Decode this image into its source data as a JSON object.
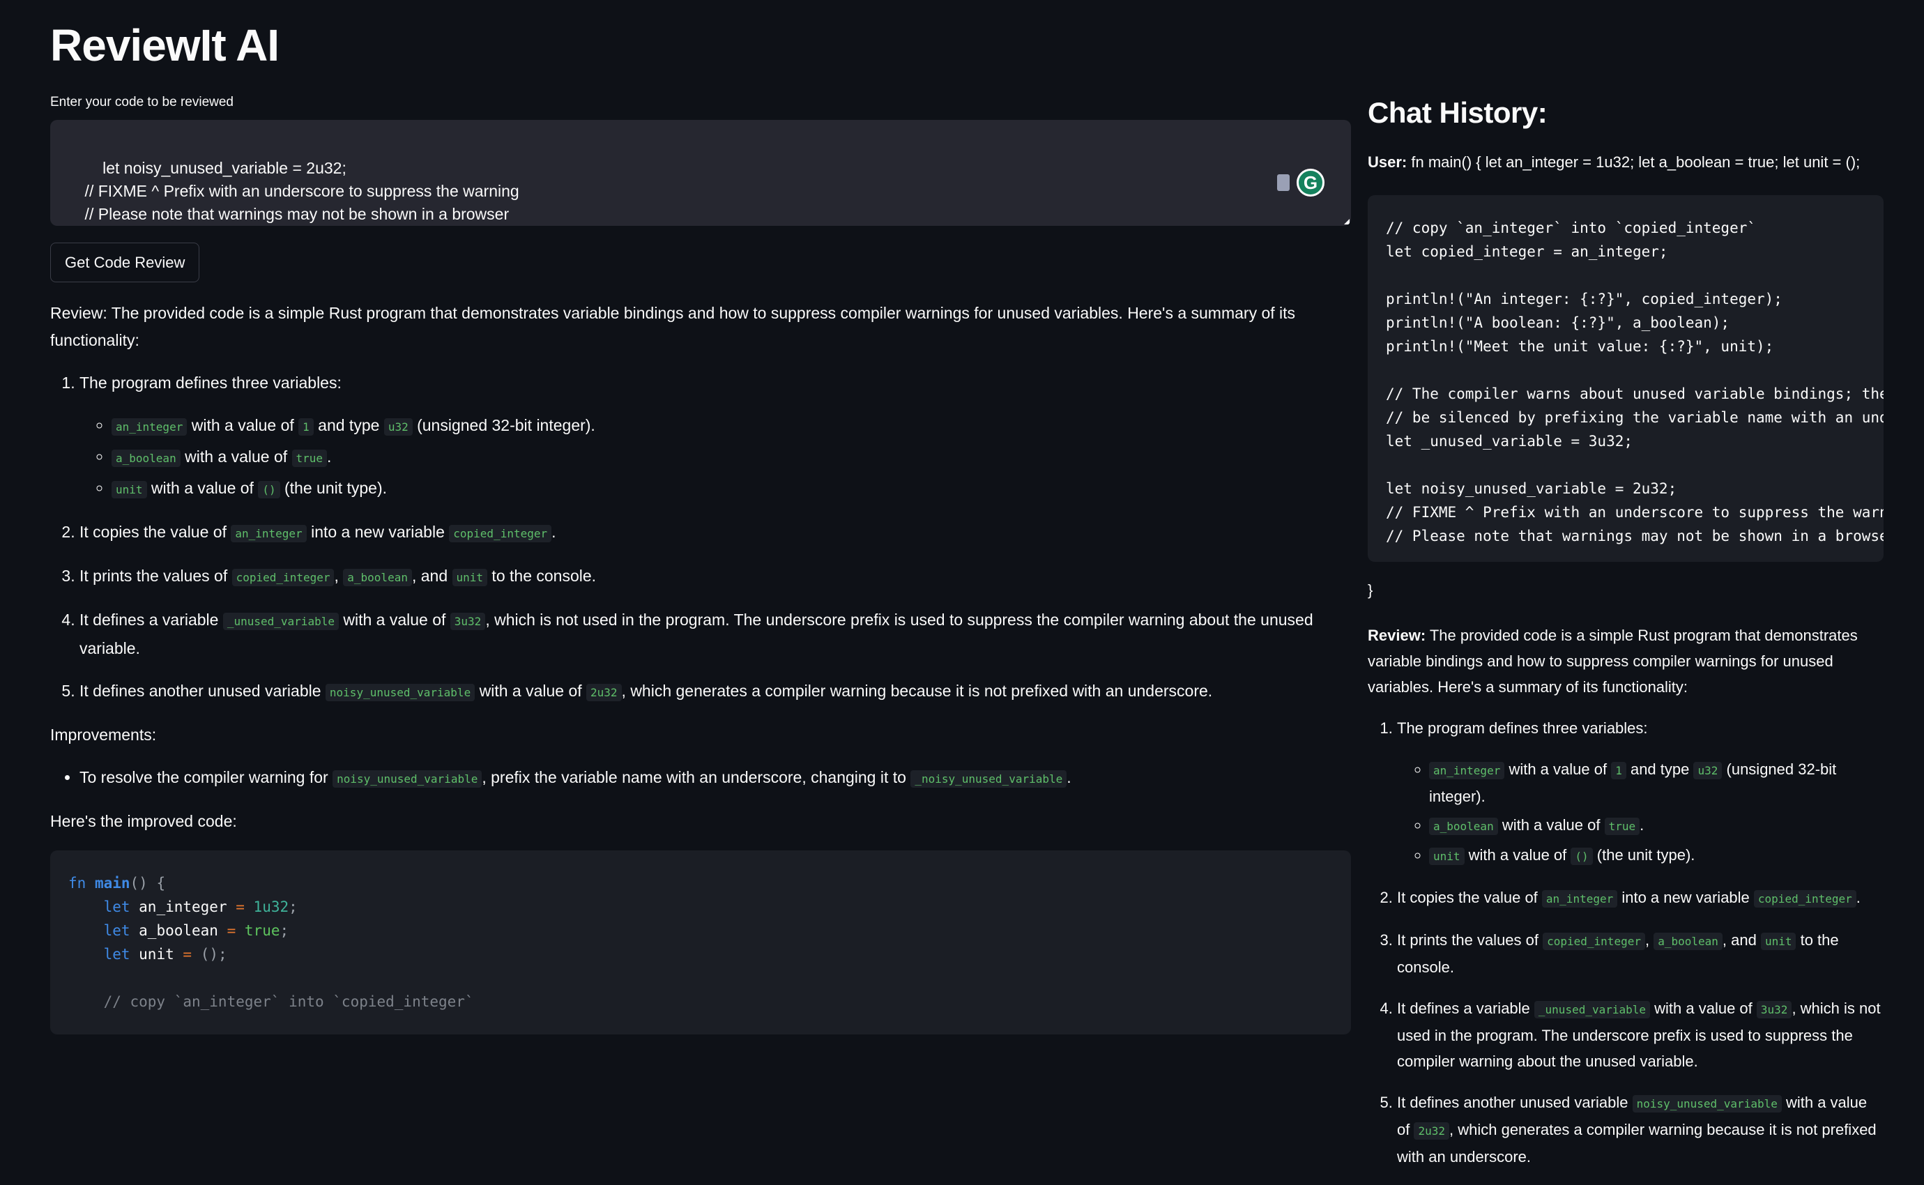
{
  "app": {
    "title": "ReviewIt AI"
  },
  "input": {
    "label": "Enter your code to be reviewed",
    "value": "    let noisy_unused_variable = 2u32;\n    // FIXME ^ Prefix with an underscore to suppress the warning\n    // Please note that warnings may not be shown in a browser\n}",
    "grammarly_icon": "G"
  },
  "button": {
    "label": "Get Code Review"
  },
  "review": {
    "intro": [
      {
        "t": "Review: The provided code is a simple Rust program that demonstrates variable bindings and how to suppress compiler warnings for unused variables. Here's a summary of its functionality:"
      }
    ],
    "items": [
      {
        "parts": [
          {
            "t": "The program defines three variables:"
          }
        ],
        "sub": [
          [
            {
              "t": "an_integer",
              "c": 1
            },
            {
              "t": " with a value of "
            },
            {
              "t": "1",
              "c": 1
            },
            {
              "t": " and type "
            },
            {
              "t": "u32",
              "c": 1
            },
            {
              "t": " (unsigned 32-bit integer)."
            }
          ],
          [
            {
              "t": "a_boolean",
              "c": 1
            },
            {
              "t": " with a value of "
            },
            {
              "t": "true",
              "c": 1
            },
            {
              "t": "."
            }
          ],
          [
            {
              "t": "unit",
              "c": 1
            },
            {
              "t": " with a value of "
            },
            {
              "t": "()",
              "c": 1
            },
            {
              "t": " (the unit type)."
            }
          ]
        ]
      },
      {
        "parts": [
          {
            "t": "It copies the value of "
          },
          {
            "t": "an_integer",
            "c": 1
          },
          {
            "t": " into a new variable "
          },
          {
            "t": "copied_integer",
            "c": 1
          },
          {
            "t": "."
          }
        ]
      },
      {
        "parts": [
          {
            "t": "It prints the values of "
          },
          {
            "t": "copied_integer",
            "c": 1
          },
          {
            "t": ", "
          },
          {
            "t": "a_boolean",
            "c": 1
          },
          {
            "t": ", and "
          },
          {
            "t": "unit",
            "c": 1
          },
          {
            "t": " to the console."
          }
        ]
      },
      {
        "parts": [
          {
            "t": "It defines a variable "
          },
          {
            "t": "_unused_variable",
            "c": 1
          },
          {
            "t": " with a value of "
          },
          {
            "t": "3u32",
            "c": 1
          },
          {
            "t": ", which is not used in the program. The underscore prefix is used to suppress the compiler warning about the unused variable."
          }
        ]
      },
      {
        "parts": [
          {
            "t": "It defines another unused variable "
          },
          {
            "t": "noisy_unused_variable",
            "c": 1
          },
          {
            "t": " with a value of "
          },
          {
            "t": "2u32",
            "c": 1
          },
          {
            "t": ", which generates a compiler warning because it is not prefixed with an underscore."
          }
        ]
      }
    ],
    "improvements_label": "Improvements:",
    "improvements": [
      [
        {
          "t": "To resolve the compiler warning for "
        },
        {
          "t": "noisy_unused_variable",
          "c": 1
        },
        {
          "t": ", prefix the variable name with an underscore, changing it to "
        },
        {
          "t": "_noisy_unused_variable",
          "c": 1
        },
        {
          "t": "."
        }
      ]
    ],
    "improved_label": "Here's the improved code:",
    "improved_code": [
      [
        {
          "t": "fn",
          "k": "kw"
        },
        {
          "t": " "
        },
        {
          "t": "main",
          "k": "fn"
        },
        {
          "t": "() {",
          "k": "pn"
        }
      ],
      [
        {
          "t": "    "
        },
        {
          "t": "let",
          "k": "kw"
        },
        {
          "t": " an_integer "
        },
        {
          "t": "=",
          "k": "op"
        },
        {
          "t": " "
        },
        {
          "t": "1u32",
          "k": "num"
        },
        {
          "t": ";",
          "k": "pn"
        }
      ],
      [
        {
          "t": "    "
        },
        {
          "t": "let",
          "k": "kw"
        },
        {
          "t": " a_boolean "
        },
        {
          "t": "=",
          "k": "op"
        },
        {
          "t": " "
        },
        {
          "t": "true",
          "k": "bool"
        },
        {
          "t": ";",
          "k": "pn"
        }
      ],
      [
        {
          "t": "    "
        },
        {
          "t": "let",
          "k": "kw"
        },
        {
          "t": " unit "
        },
        {
          "t": "=",
          "k": "op"
        },
        {
          "t": " "
        },
        {
          "t": "();",
          "k": "pn"
        }
      ],
      [
        {
          "t": " "
        }
      ],
      [
        {
          "t": "    // copy `an_integer` into `copied_integer`",
          "k": "cm"
        }
      ]
    ]
  },
  "chat_history": {
    "title": "Chat History:",
    "user_label": "User:",
    "user_text": " fn main() { let an_integer = 1u32; let a_boolean = true; let unit = ();",
    "code": "// copy `an_integer` into `copied_integer`\nlet copied_integer = an_integer;\n\nprintln!(\"An integer: {:?}\", copied_integer);\nprintln!(\"A boolean: {:?}\", a_boolean);\nprintln!(\"Meet the unit value: {:?}\", unit);\n\n// The compiler warns about unused variable bindings; the\n// be silenced by prefixing the variable name with an und\nlet _unused_variable = 3u32;\n\nlet noisy_unused_variable = 2u32;\n// FIXME ^ Prefix with an underscore to suppress the warn\n// Please note that warnings may not be shown in a browse",
    "closing": "}",
    "review_label": "Review:",
    "review_text": " The provided code is a simple Rust program that demonstrates variable bindings and how to suppress compiler warnings for unused variables. Here's a summary of its functionality:"
  },
  "colors": {
    "background": "#0e1117",
    "inline_code": "#5fbf6a",
    "keyword": "#3f8ae6",
    "operator": "#e6772e"
  }
}
